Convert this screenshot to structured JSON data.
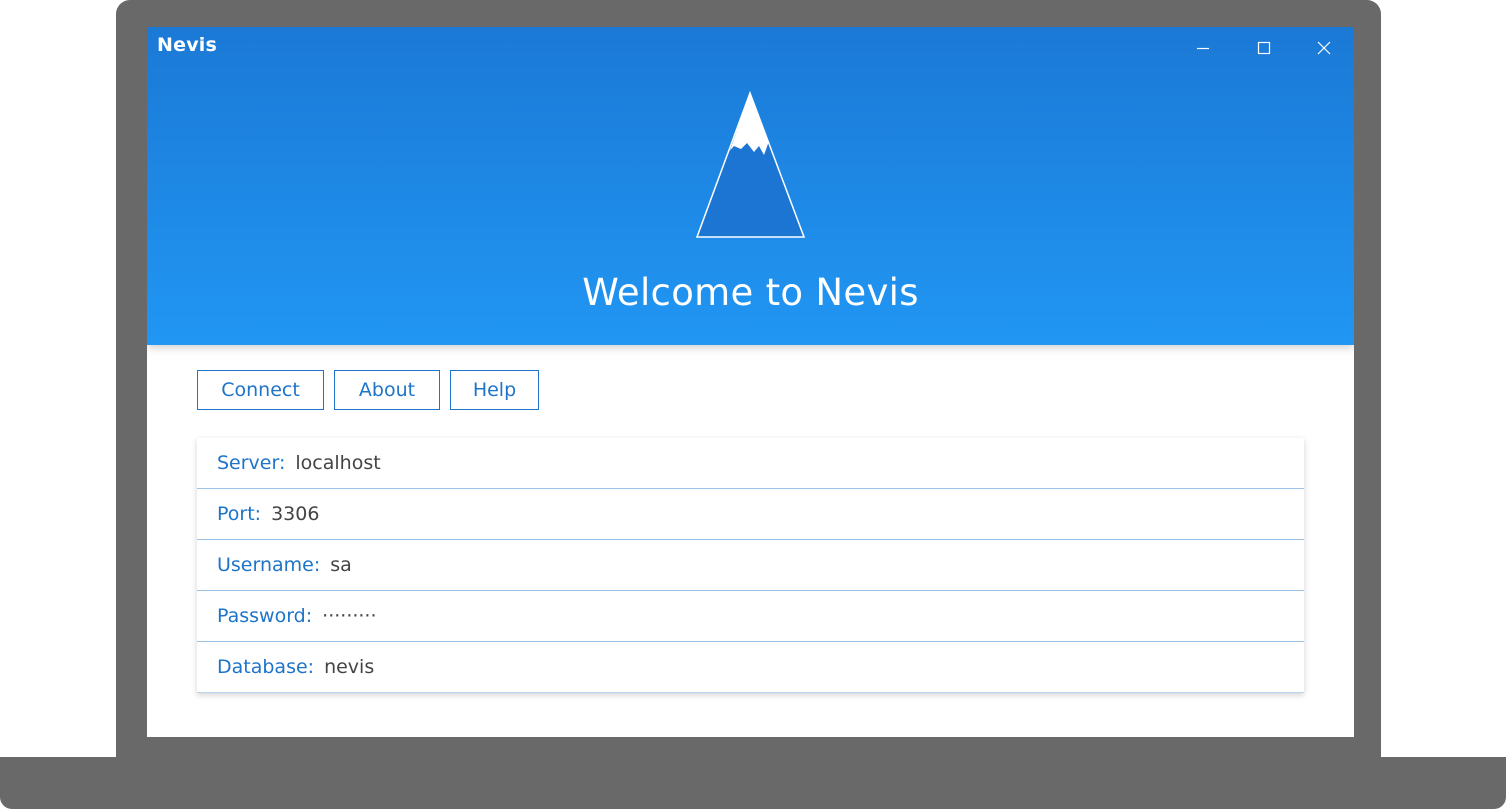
{
  "window": {
    "title": "Nevis",
    "minimize_icon": "minimize-icon",
    "maximize_icon": "maximize-icon",
    "close_icon": "close-icon"
  },
  "hero": {
    "logo_icon": "mountain-logo-icon",
    "welcome": "Welcome to Nevis"
  },
  "toolbar": {
    "connect_label": "Connect",
    "about_label": "About",
    "help_label": "Help"
  },
  "connection": {
    "fields": [
      {
        "label": "Server:",
        "value": "localhost"
      },
      {
        "label": "Port:",
        "value": "3306"
      },
      {
        "label": "Username:",
        "value": "sa"
      },
      {
        "label": "Password:",
        "value": "·········"
      },
      {
        "label": "Database:",
        "value": "nevis"
      }
    ]
  },
  "colors": {
    "accent": "#1d74c9",
    "header_top": "#1b79d6",
    "header_bottom": "#2196f3",
    "device_frame": "#696969"
  }
}
